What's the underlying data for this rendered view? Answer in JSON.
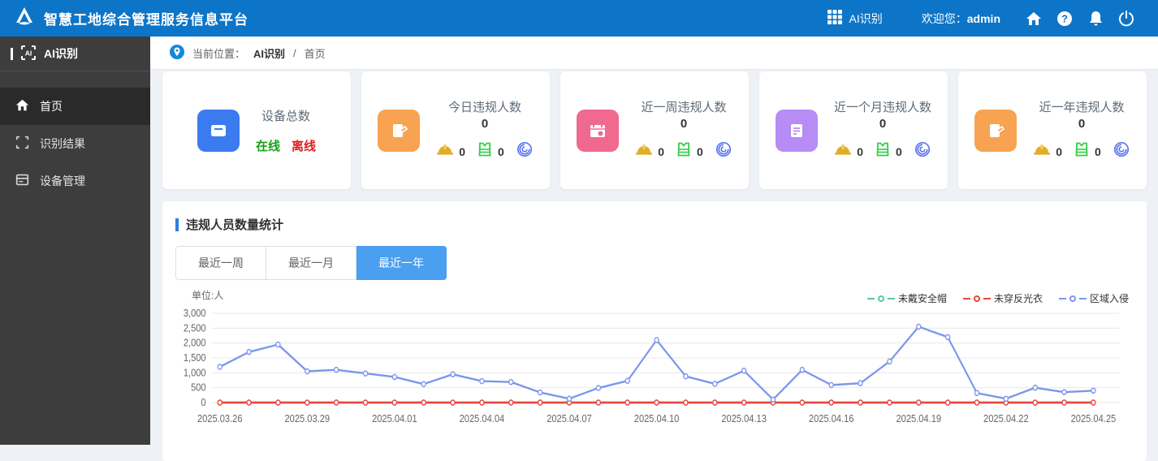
{
  "header": {
    "title": "智慧工地综合管理服务信息平台",
    "app_switch_label": "AI识别",
    "welcome_label": "欢迎您：",
    "username": "admin"
  },
  "sidebar": {
    "title": "AI识别",
    "items": [
      {
        "label": "首页",
        "active": true
      },
      {
        "label": "识别结果",
        "active": false
      },
      {
        "label": "设备管理",
        "active": false
      }
    ]
  },
  "breadcrumb": {
    "prefix": "当前位置：",
    "root": "AI识别",
    "separator": "/",
    "current": "首页"
  },
  "cards": [
    {
      "title": "设备总数",
      "online_label": "在线",
      "offline_label": "离线",
      "icon_color": "#3a7bf0"
    },
    {
      "title": "今日违规人数",
      "value": "0",
      "helmet_count": "0",
      "vest_count": "0",
      "icon_color": "#f7a351"
    },
    {
      "title": "近一周违规人数",
      "value": "0",
      "helmet_count": "0",
      "vest_count": "0",
      "icon_color": "#f0698e"
    },
    {
      "title": "近一个月违规人数",
      "value": "0",
      "helmet_count": "0",
      "vest_count": "0",
      "icon_color": "#b78cf5"
    },
    {
      "title": "近一年违规人数",
      "value": "0",
      "helmet_count": "0",
      "vest_count": "0",
      "icon_color": "#f7a351"
    }
  ],
  "stats_section": {
    "title": "违规人员数量统计",
    "tabs": [
      {
        "label": "最近一周",
        "active": false
      },
      {
        "label": "最近一月",
        "active": false
      },
      {
        "label": "最近一年",
        "active": true
      }
    ],
    "unit_label": "单位:人"
  },
  "chart_data": {
    "type": "line",
    "title": "违规人员数量统计",
    "ylabel": "单位:人",
    "ylim": [
      0,
      3000
    ],
    "y_ticks": [
      0,
      500,
      1000,
      1500,
      2000,
      2500,
      3000
    ],
    "grid": true,
    "legend_position": "top-right",
    "x_tick_step": 3,
    "x": [
      "2025.03.26",
      "2025.03.27",
      "2025.03.28",
      "2025.03.29",
      "2025.03.30",
      "2025.03.31",
      "2025.04.01",
      "2025.04.02",
      "2025.04.03",
      "2025.04.04",
      "2025.04.05",
      "2025.04.06",
      "2025.04.07",
      "2025.04.08",
      "2025.04.09",
      "2025.04.10",
      "2025.04.11",
      "2025.04.12",
      "2025.04.13",
      "2025.04.14",
      "2025.04.15",
      "2025.04.16",
      "2025.04.17",
      "2025.04.18",
      "2025.04.19",
      "2025.04.20",
      "2025.04.21",
      "2025.04.22",
      "2025.04.23",
      "2025.04.24",
      "2025.04.25"
    ],
    "series": [
      {
        "name": "未戴安全帽",
        "color": "#58c9a0",
        "values": [
          0,
          0,
          0,
          0,
          0,
          0,
          0,
          0,
          0,
          0,
          0,
          0,
          0,
          0,
          0,
          0,
          0,
          0,
          0,
          0,
          0,
          0,
          0,
          0,
          0,
          0,
          0,
          0,
          0,
          0,
          0
        ]
      },
      {
        "name": "未穿反光衣",
        "color": "#e8453a",
        "values": [
          0,
          0,
          0,
          0,
          0,
          0,
          0,
          0,
          0,
          0,
          0,
          0,
          0,
          0,
          0,
          0,
          0,
          0,
          0,
          0,
          0,
          0,
          0,
          0,
          0,
          0,
          0,
          0,
          0,
          0,
          0
        ]
      },
      {
        "name": "区域入侵",
        "color": "#7d96ec",
        "values": [
          1200,
          1700,
          1950,
          1050,
          1100,
          980,
          860,
          620,
          950,
          720,
          690,
          340,
          130,
          490,
          730,
          2100,
          880,
          630,
          1070,
          100,
          1100,
          590,
          650,
          1380,
          2550,
          2200,
          320,
          130,
          500,
          350,
          400
        ]
      }
    ]
  }
}
